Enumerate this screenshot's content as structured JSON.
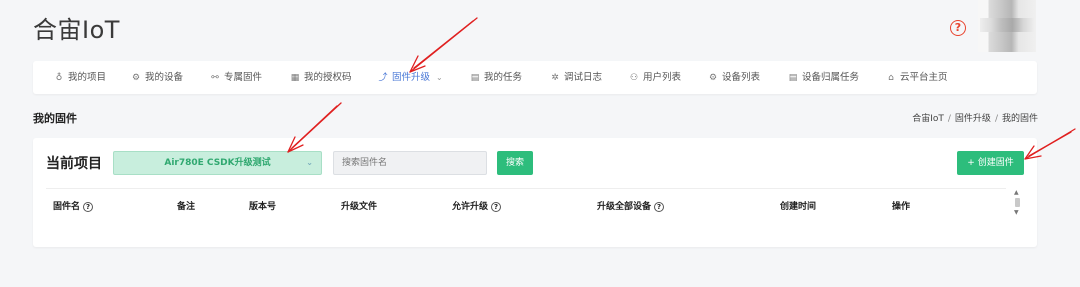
{
  "header": {
    "app_title": "合宙IoT",
    "help_icon": "?"
  },
  "nav": {
    "items": [
      {
        "label": "我的项目",
        "icon": "bulb-icon",
        "glyph": "♁"
      },
      {
        "label": "我的设备",
        "icon": "device-icon",
        "glyph": "⚙"
      },
      {
        "label": "专属固件",
        "icon": "wand-icon",
        "glyph": "⚯"
      },
      {
        "label": "我的授权码",
        "icon": "qr-icon",
        "glyph": "▦"
      },
      {
        "label": "固件升级",
        "icon": "trend-icon",
        "glyph": "⤴"
      },
      {
        "label": "我的任务",
        "icon": "clipboard-icon",
        "glyph": "▤"
      },
      {
        "label": "调试日志",
        "icon": "bug-icon",
        "glyph": "✲"
      },
      {
        "label": "用户列表",
        "icon": "users-icon",
        "glyph": "⚇"
      },
      {
        "label": "设备列表",
        "icon": "settings-icon",
        "glyph": "⚙"
      },
      {
        "label": "设备归属任务",
        "icon": "clipboard-icon",
        "glyph": "▤"
      },
      {
        "label": "云平台主页",
        "icon": "home-icon",
        "glyph": "⌂"
      }
    ],
    "active_caret": "⌄"
  },
  "page": {
    "title": "我的固件",
    "breadcrumb": [
      "合宙IoT",
      "固件升级",
      "我的固件"
    ],
    "breadcrumb_sep": "/"
  },
  "toolbar": {
    "project_label": "当前项目",
    "project_value": "Air780E CSDK升级测试",
    "search_placeholder": "搜索固件名",
    "search_button": "搜索",
    "create_button": "+ 创建固件"
  },
  "table": {
    "headers": [
      "固件名",
      "备注",
      "版本号",
      "升级文件",
      "允许升级",
      "升级全部设备",
      "创建时间",
      "操作"
    ],
    "help_mark": "?"
  },
  "colors": {
    "accent_green": "#2dbd7c",
    "active_nav": "#4a78d6",
    "annotation_arrow": "#e02020"
  }
}
